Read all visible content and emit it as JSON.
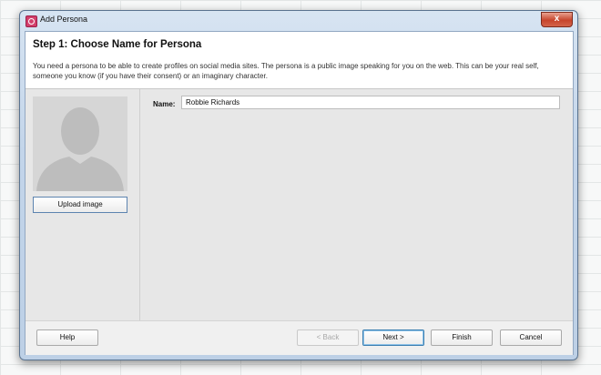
{
  "window": {
    "title": "Add Persona",
    "close_label": "x"
  },
  "header": {
    "step_title": "Step 1: Choose Name for Persona",
    "description": "You need a persona to be able to create profiles on social media sites. The persona is a public image speaking for you on the web. This can be your real self, someone you know (if you have their consent) or an imaginary character."
  },
  "left_panel": {
    "upload_label": "Upload image"
  },
  "form": {
    "name_label": "Name:",
    "name_value": "Robbie Richards"
  },
  "footer": {
    "help_label": "Help",
    "back_label": "< Back",
    "next_label": "Next >",
    "finish_label": "Finish",
    "cancel_label": "Cancel"
  },
  "colors": {
    "accent": "#3c7fb1",
    "app_icon": "#d23f6c",
    "close_button": "#c7452c"
  }
}
